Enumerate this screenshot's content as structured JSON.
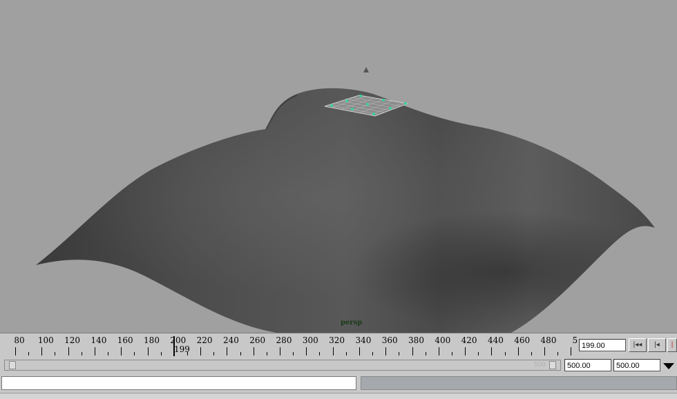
{
  "viewport": {
    "camera": "persp",
    "background_color": "#a0a0a0",
    "surface_color": "#555555"
  },
  "timeline": {
    "ticks": [
      "80",
      "100",
      "120",
      "140",
      "160",
      "180",
      "200",
      "220",
      "240",
      "260",
      "280",
      "300",
      "320",
      "340",
      "360",
      "380",
      "400",
      "420",
      "440",
      "460",
      "480",
      "5"
    ],
    "current_frame_label": "199",
    "current_time": "199.00",
    "icons": {
      "go_start": "go-to-start-icon",
      "step_back": "step-back-key-icon",
      "play_back": "play-backwards-icon"
    }
  },
  "range": {
    "end_time": "500.00",
    "anim_end": "500.00",
    "slider_end_ghost": "500",
    "menu_icon": "dropdown-triangle-icon"
  },
  "command": {
    "input_value": "",
    "result_value": ""
  }
}
